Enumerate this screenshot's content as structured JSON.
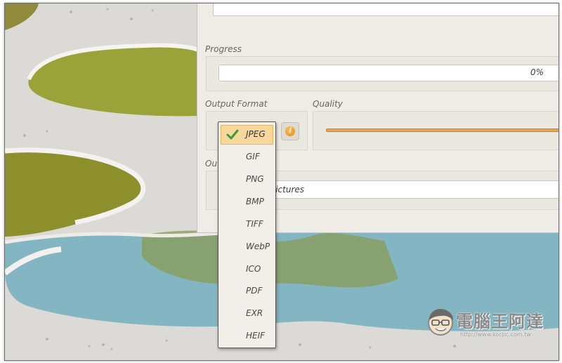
{
  "window": {
    "progress_label": "Progress",
    "progress_value": "0%",
    "progress_fraction": 0,
    "output_format_label": "Output Format",
    "quality_label": "Quality",
    "output_partial_label": "Ou",
    "output_path_partial": "r/Pictures"
  },
  "format_menu": {
    "selected": "JPEG",
    "items": [
      "JPEG",
      "GIF",
      "PNG",
      "BMP",
      "TIFF",
      "WebP",
      "ICO",
      "PDF",
      "EXR",
      "HEIF"
    ]
  },
  "help_button": {
    "glyph": "i"
  },
  "watermark": {
    "title": "電腦王阿達",
    "url": "http://www.kocpc.com.tw"
  },
  "colors": {
    "menu_highlight": "#f7d79b",
    "slider_accent": "#e7a44d",
    "check_green": "#3f9a3b",
    "window_bg": "#efebe6"
  }
}
